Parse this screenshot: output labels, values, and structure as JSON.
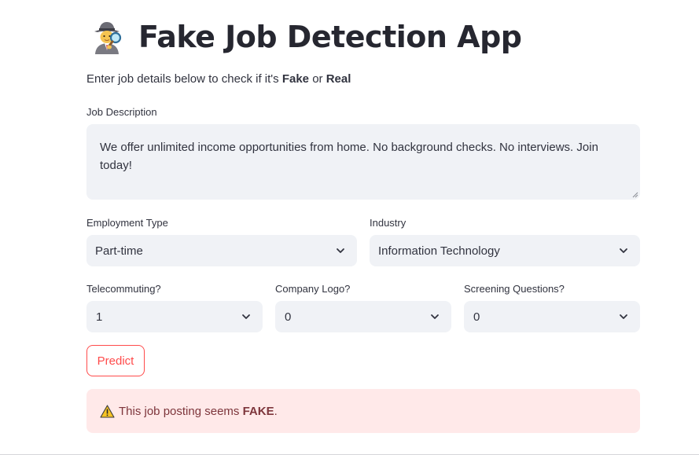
{
  "header": {
    "icon": "detective-emoji-icon",
    "title": "Fake Job Detection App"
  },
  "intro": {
    "prefix": "Enter job details below to check if it's ",
    "fake": "Fake",
    "or": " or ",
    "real": "Real"
  },
  "job_description": {
    "label": "Job Description",
    "value": "We offer unlimited income opportunities from home. No background checks. No interviews. Join today!"
  },
  "employment_type": {
    "label": "Employment Type",
    "selected": "Part-time"
  },
  "industry": {
    "label": "Industry",
    "selected": "Information Technology"
  },
  "telecommuting": {
    "label": "Telecommuting?",
    "selected": "1"
  },
  "company_logo": {
    "label": "Company Logo?",
    "selected": "0"
  },
  "screening_questions": {
    "label": "Screening Questions?",
    "selected": "0"
  },
  "predict_button": {
    "label": "Predict"
  },
  "result": {
    "icon": "warning-icon",
    "prefix": "This job posting seems ",
    "verdict": "FAKE",
    "suffix": "."
  },
  "colors": {
    "accent": "#ff4b4b",
    "input_bg": "#f0f2f6",
    "alert_bg": "#ffe9e9",
    "alert_text": "#7d353b"
  }
}
